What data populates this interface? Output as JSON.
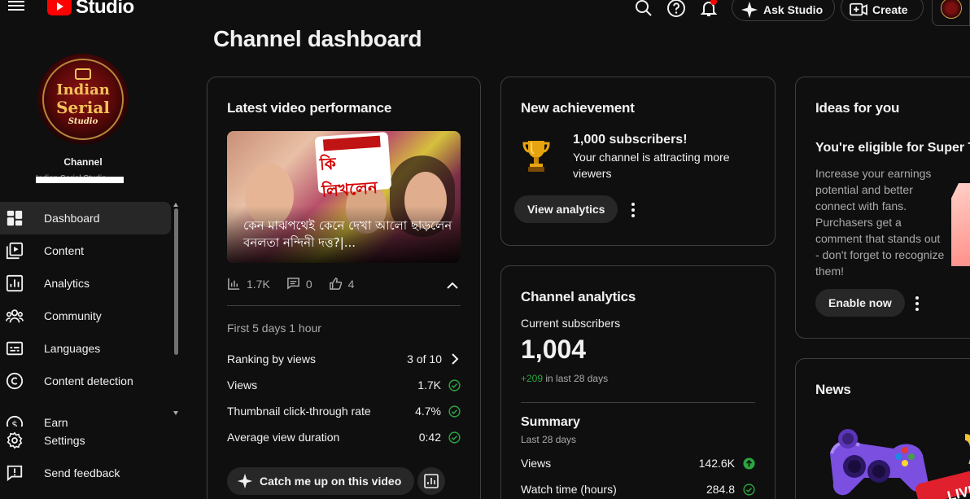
{
  "header": {
    "app_name": "Studio",
    "ask_studio_label": "Ask Studio",
    "create_label": "Create"
  },
  "sidebar": {
    "channel_avatar_text": {
      "line1": "Indian",
      "line2": "Serial",
      "line3": "Studio"
    },
    "channel_label": "Channel",
    "channel_name": "Indian Serial Studio",
    "items": [
      {
        "label": "Dashboard",
        "icon": "dashboard-icon",
        "active": true
      },
      {
        "label": "Content",
        "icon": "content-icon"
      },
      {
        "label": "Analytics",
        "icon": "analytics-icon"
      },
      {
        "label": "Community",
        "icon": "community-icon"
      },
      {
        "label": "Languages",
        "icon": "languages-icon"
      },
      {
        "label": "Content detection",
        "icon": "copyright-icon"
      },
      {
        "label": "Earn",
        "icon": "earn-icon"
      }
    ],
    "bottom_items": [
      {
        "label": "Settings",
        "icon": "gear-icon"
      },
      {
        "label": "Send feedback",
        "icon": "feedback-icon"
      }
    ]
  },
  "main": {
    "page_title": "Channel dashboard",
    "latest_video": {
      "title": "Latest video performance",
      "thumbnail_overlay_bengali": "কি লিখলেন",
      "video_title": "কেন মাঝপথেই কেনে দেখা আলো ছাড়লেন বনলতা নন্দিনী দত্ত?|...",
      "views_short": "1.7K",
      "comments": "0",
      "likes": "4",
      "period": "First 5 days 1 hour",
      "metrics": [
        {
          "label": "Ranking by views",
          "value": "3 of 10",
          "indicator": "chevron-right-icon"
        },
        {
          "label": "Views",
          "value": "1.7K",
          "indicator": "check-circle-icon"
        },
        {
          "label": "Thumbnail click-through rate",
          "value": "4.7%",
          "indicator": "check-circle-icon"
        },
        {
          "label": "Average view duration",
          "value": "0:42",
          "indicator": "check-circle-icon"
        }
      ],
      "catch_up_label": "Catch me up on this video"
    },
    "achievement": {
      "title": "New achievement",
      "headline": "1,000 subscribers!",
      "description": "Your channel is attracting more viewers",
      "button_label": "View analytics"
    },
    "channel_analytics": {
      "title": "Channel analytics",
      "current_subscribers_label": "Current subscribers",
      "current_subscribers": "1,004",
      "delta": "+209",
      "delta_suffix": "in last 28 days",
      "summary_title": "Summary",
      "summary_period": "Last 28 days",
      "summary": [
        {
          "label": "Views",
          "value": "142.6K",
          "indicator": "arrow-up-circle-icon"
        },
        {
          "label": "Watch time (hours)",
          "value": "284.8",
          "indicator": "check-circle-icon"
        }
      ]
    },
    "ideas": {
      "title": "Ideas for you",
      "headline": "You're eligible for Super Th",
      "body": "Increase your earnings potential and better connect with fans. Purchasers get a comment that stands out - don't forget to recognize them!",
      "button_label": "Enable now"
    },
    "news": {
      "title": "News",
      "badge": "LIVE"
    }
  },
  "colors": {
    "background": "#0f0f0f",
    "card_border": "#3f3f3f",
    "button_bg": "#272727",
    "positive_green": "#2ba640",
    "brand_red": "#ff0000"
  }
}
